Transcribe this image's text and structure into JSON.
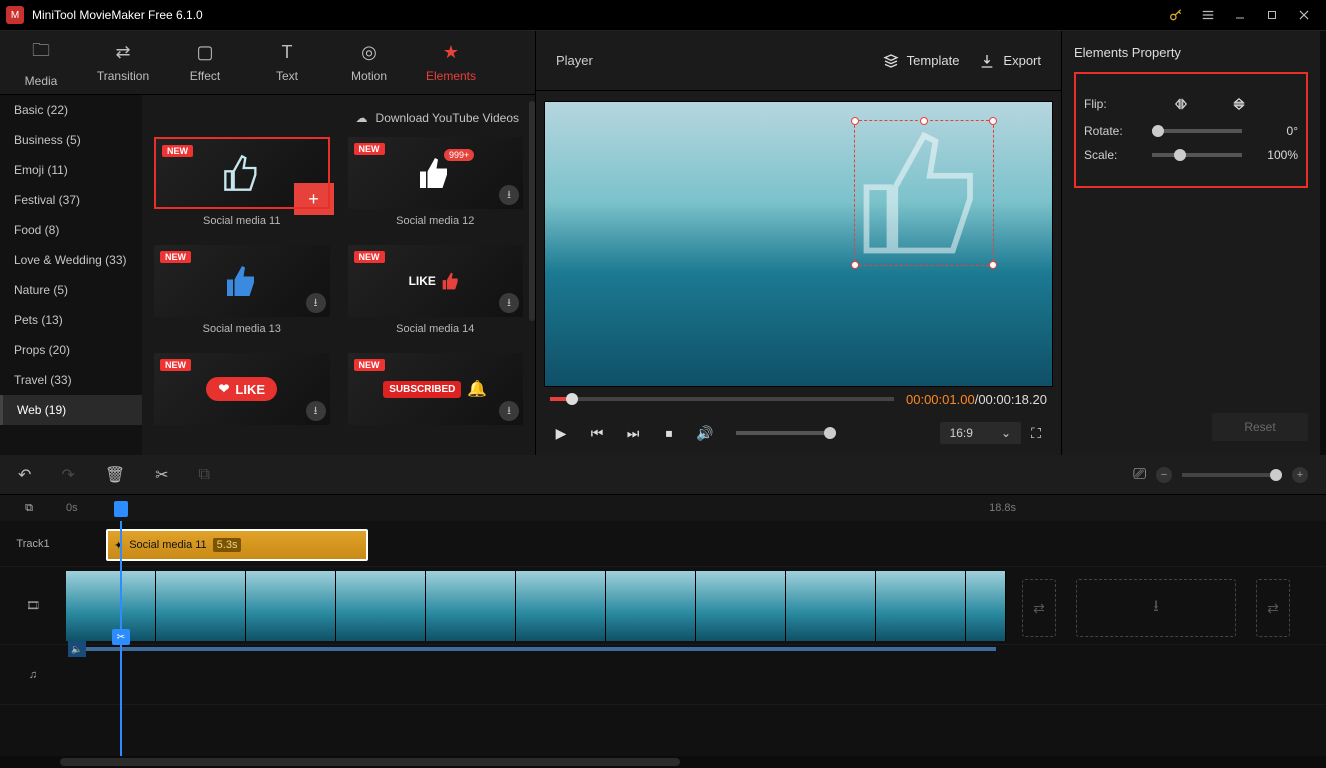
{
  "app": {
    "title": "MiniTool MovieMaker Free 6.1.0"
  },
  "tabs": {
    "media": "Media",
    "transition": "Transition",
    "effect": "Effect",
    "text": "Text",
    "motion": "Motion",
    "elements": "Elements"
  },
  "categories": {
    "basic": "Basic (22)",
    "business": "Business (5)",
    "emoji": "Emoji (11)",
    "festival": "Festival (37)",
    "food": "Food (8)",
    "love": "Love & Wedding (33)",
    "nature": "Nature (5)",
    "pets": "Pets (13)",
    "props": "Props (20)",
    "travel": "Travel (33)",
    "web": "Web (19)"
  },
  "assets": {
    "download_yt": "Download YouTube Videos",
    "new_badge": "NEW",
    "items": {
      "0": "Social media 11",
      "1": "Social media 12",
      "2": "Social media 13",
      "3": "Social media 14"
    },
    "badge999": "999+",
    "like_label": "LIKE",
    "sub_label": "SUBSCRIBED"
  },
  "player": {
    "title": "Player",
    "template": "Template",
    "export": "Export",
    "cur": "00:00:01.00",
    "sep": " / ",
    "total": "00:00:18.20",
    "aspect": "16:9"
  },
  "props": {
    "title": "Elements Property",
    "flip": "Flip:",
    "rotate": "Rotate:",
    "rotate_val": "0°",
    "scale": "Scale:",
    "scale_val": "100%",
    "reset": "Reset"
  },
  "timeline": {
    "t0": "0s",
    "t1": "18.8s",
    "track1": "Track1",
    "clip_name": "Social media 11",
    "clip_dur": "5.3s"
  }
}
